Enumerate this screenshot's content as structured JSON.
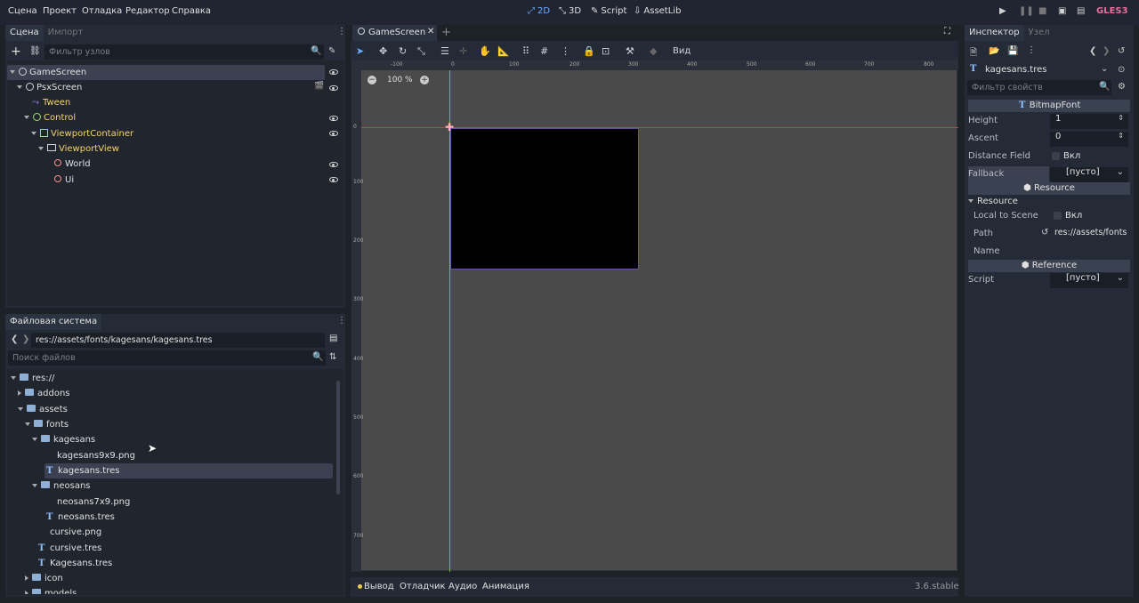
{
  "menu": [
    "Сцена",
    "Проект",
    "Отладка",
    "Редактор",
    "Справка"
  ],
  "modes": [
    {
      "label": "2D",
      "icon": "2d-icon",
      "active": true
    },
    {
      "label": "3D",
      "icon": "3d-icon",
      "active": false
    },
    {
      "label": "Script",
      "icon": "script-icon",
      "active": false
    },
    {
      "label": "AssetLib",
      "icon": "assetlib-icon",
      "active": false
    }
  ],
  "renderer": "GLES3",
  "scene_dock": {
    "tabs": [
      "Сцена",
      "Импорт"
    ],
    "filter_placeholder": "Фильтр узлов",
    "nodes": [
      {
        "label": "GameScreen",
        "depth": 0,
        "icon": "node-icon",
        "eye": true,
        "selected": true
      },
      {
        "label": "PsxScreen",
        "depth": 1,
        "icon": "node-icon",
        "eye": true,
        "film": true
      },
      {
        "label": "Tween",
        "depth": 2,
        "icon": "tween-icon",
        "eye": false
      },
      {
        "label": "Control",
        "depth": 2,
        "icon": "control-icon",
        "eye": true
      },
      {
        "label": "ViewportContainer",
        "depth": 3,
        "icon": "viewport-container-icon",
        "eye": true
      },
      {
        "label": "ViewportView",
        "depth": 4,
        "icon": "viewport-icon",
        "eye": false
      },
      {
        "label": "World",
        "depth": 5,
        "icon": "spatial-icon",
        "eye": true
      },
      {
        "label": "Ui",
        "depth": 5,
        "icon": "spatial-icon",
        "eye": true
      }
    ]
  },
  "filesystem": {
    "title": "Файловая система",
    "path": "res://assets/fonts/kagesans/kagesans.tres",
    "search_placeholder": "Поиск файлов",
    "items": [
      {
        "label": "res://",
        "depth": 0,
        "type": "folder",
        "open": true
      },
      {
        "label": "addons",
        "depth": 1,
        "type": "folder",
        "open": false
      },
      {
        "label": "assets",
        "depth": 1,
        "type": "folder",
        "open": true
      },
      {
        "label": "fonts",
        "depth": 2,
        "type": "folder",
        "open": true
      },
      {
        "label": "kagesans",
        "depth": 3,
        "type": "folder",
        "open": true
      },
      {
        "label": "kagesans9x9.png",
        "depth": 4,
        "type": "image"
      },
      {
        "label": "kagesans.tres",
        "depth": 4,
        "type": "font",
        "selected": true
      },
      {
        "label": "neosans",
        "depth": 3,
        "type": "folder",
        "open": true
      },
      {
        "label": "neosans7x9.png",
        "depth": 4,
        "type": "image"
      },
      {
        "label": "neosans.tres",
        "depth": 4,
        "type": "font"
      },
      {
        "label": "cursive.png",
        "depth": 3,
        "type": "image"
      },
      {
        "label": "cursive.tres",
        "depth": 3,
        "type": "font"
      },
      {
        "label": "Kagesans.tres",
        "depth": 3,
        "type": "font"
      },
      {
        "label": "icon",
        "depth": 2,
        "type": "folder",
        "open": false
      },
      {
        "label": "models",
        "depth": 2,
        "type": "folder",
        "open": false
      }
    ]
  },
  "editor": {
    "tab": "GameScreen",
    "view_label": "Вид",
    "zoom": "100 %",
    "ruler_labels": [
      "-100",
      "0",
      "100",
      "200",
      "300",
      "400",
      "500",
      "600",
      "700",
      "800"
    ],
    "vruler_labels": [
      "0",
      "100",
      "200",
      "300",
      "400",
      "500",
      "600",
      "700"
    ]
  },
  "bottom": {
    "tabs": [
      "Вывод",
      "Отладчик",
      "Аудио",
      "Анимация"
    ],
    "version": "3.6.stable"
  },
  "inspector": {
    "tabs": [
      "Инспектор",
      "Узел"
    ],
    "resource_name": "kagesans.tres",
    "filter_placeholder": "Фильтр свойств",
    "class_header": "BitmapFont",
    "props": [
      {
        "label": "Height",
        "value": "1",
        "type": "spin"
      },
      {
        "label": "Ascent",
        "value": "0",
        "type": "spin"
      },
      {
        "label": "Distance Field",
        "value": "Вкл",
        "type": "check"
      },
      {
        "label": "Fallback",
        "value": "[пусто]",
        "type": "dropdown"
      }
    ],
    "resource_header": "Resource",
    "resource_group": "Resource",
    "resource_props": [
      {
        "label": "Local to Scene",
        "value": "Вкл",
        "type": "check"
      },
      {
        "label": "Path",
        "value": "res://assets/fonts",
        "type": "path"
      },
      {
        "label": "Name",
        "value": "",
        "type": "text"
      }
    ],
    "reference_header": "Reference",
    "script_label": "Script",
    "script_value": "[пусто]"
  },
  "colors": {
    "accent": "#6ab0ff",
    "renderer": "#e7709b",
    "canvas": "#4a4a4a",
    "game_rect": "#000000"
  }
}
